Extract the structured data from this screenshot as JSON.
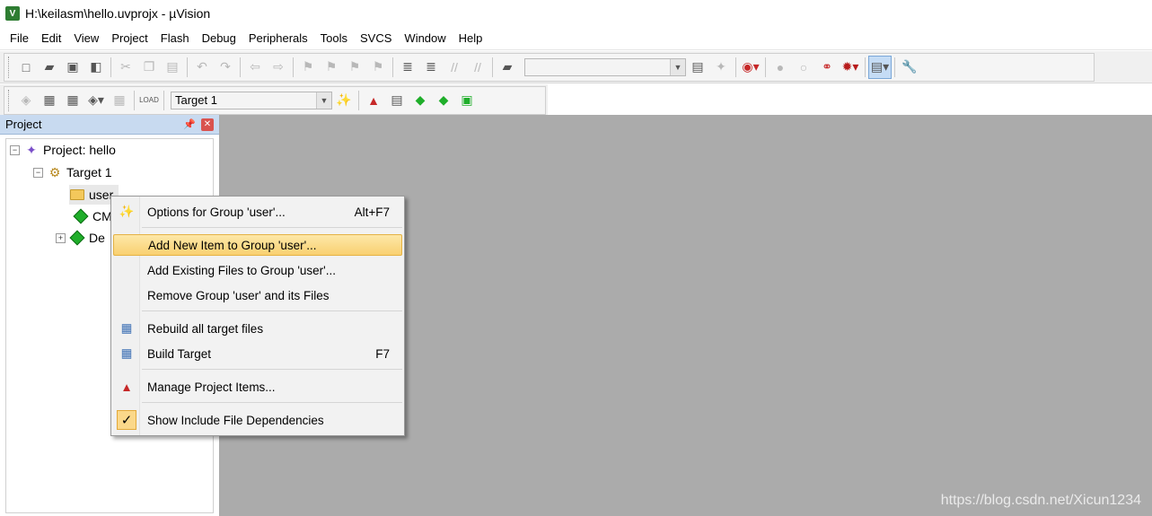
{
  "window": {
    "title": "H:\\keilasm\\hello.uvprojx - µVision",
    "icon_text": "V"
  },
  "menu": [
    "File",
    "Edit",
    "View",
    "Project",
    "Flash",
    "Debug",
    "Peripherals",
    "Tools",
    "SVCS",
    "Window",
    "Help"
  ],
  "toolbar2": {
    "target_value": "Target 1"
  },
  "project_panel": {
    "title": "Project",
    "tree": {
      "project": "Project: hello",
      "target": "Target 1",
      "items": [
        "user",
        "CM",
        "De"
      ]
    }
  },
  "context_menu": {
    "items": [
      {
        "label": "Options for Group 'user'...",
        "shortcut": "Alt+F7"
      },
      {
        "label": "Add New  Item to Group 'user'...",
        "shortcut": ""
      },
      {
        "label": "Add Existing Files to Group 'user'...",
        "shortcut": ""
      },
      {
        "label": "Remove Group 'user' and its Files",
        "shortcut": ""
      },
      {
        "label": "Rebuild all target files",
        "shortcut": ""
      },
      {
        "label": "Build Target",
        "shortcut": "F7"
      },
      {
        "label": "Manage Project Items...",
        "shortcut": ""
      },
      {
        "label": "Show Include File Dependencies",
        "shortcut": ""
      }
    ]
  },
  "watermark": "https://blog.csdn.net/Xicun1234"
}
